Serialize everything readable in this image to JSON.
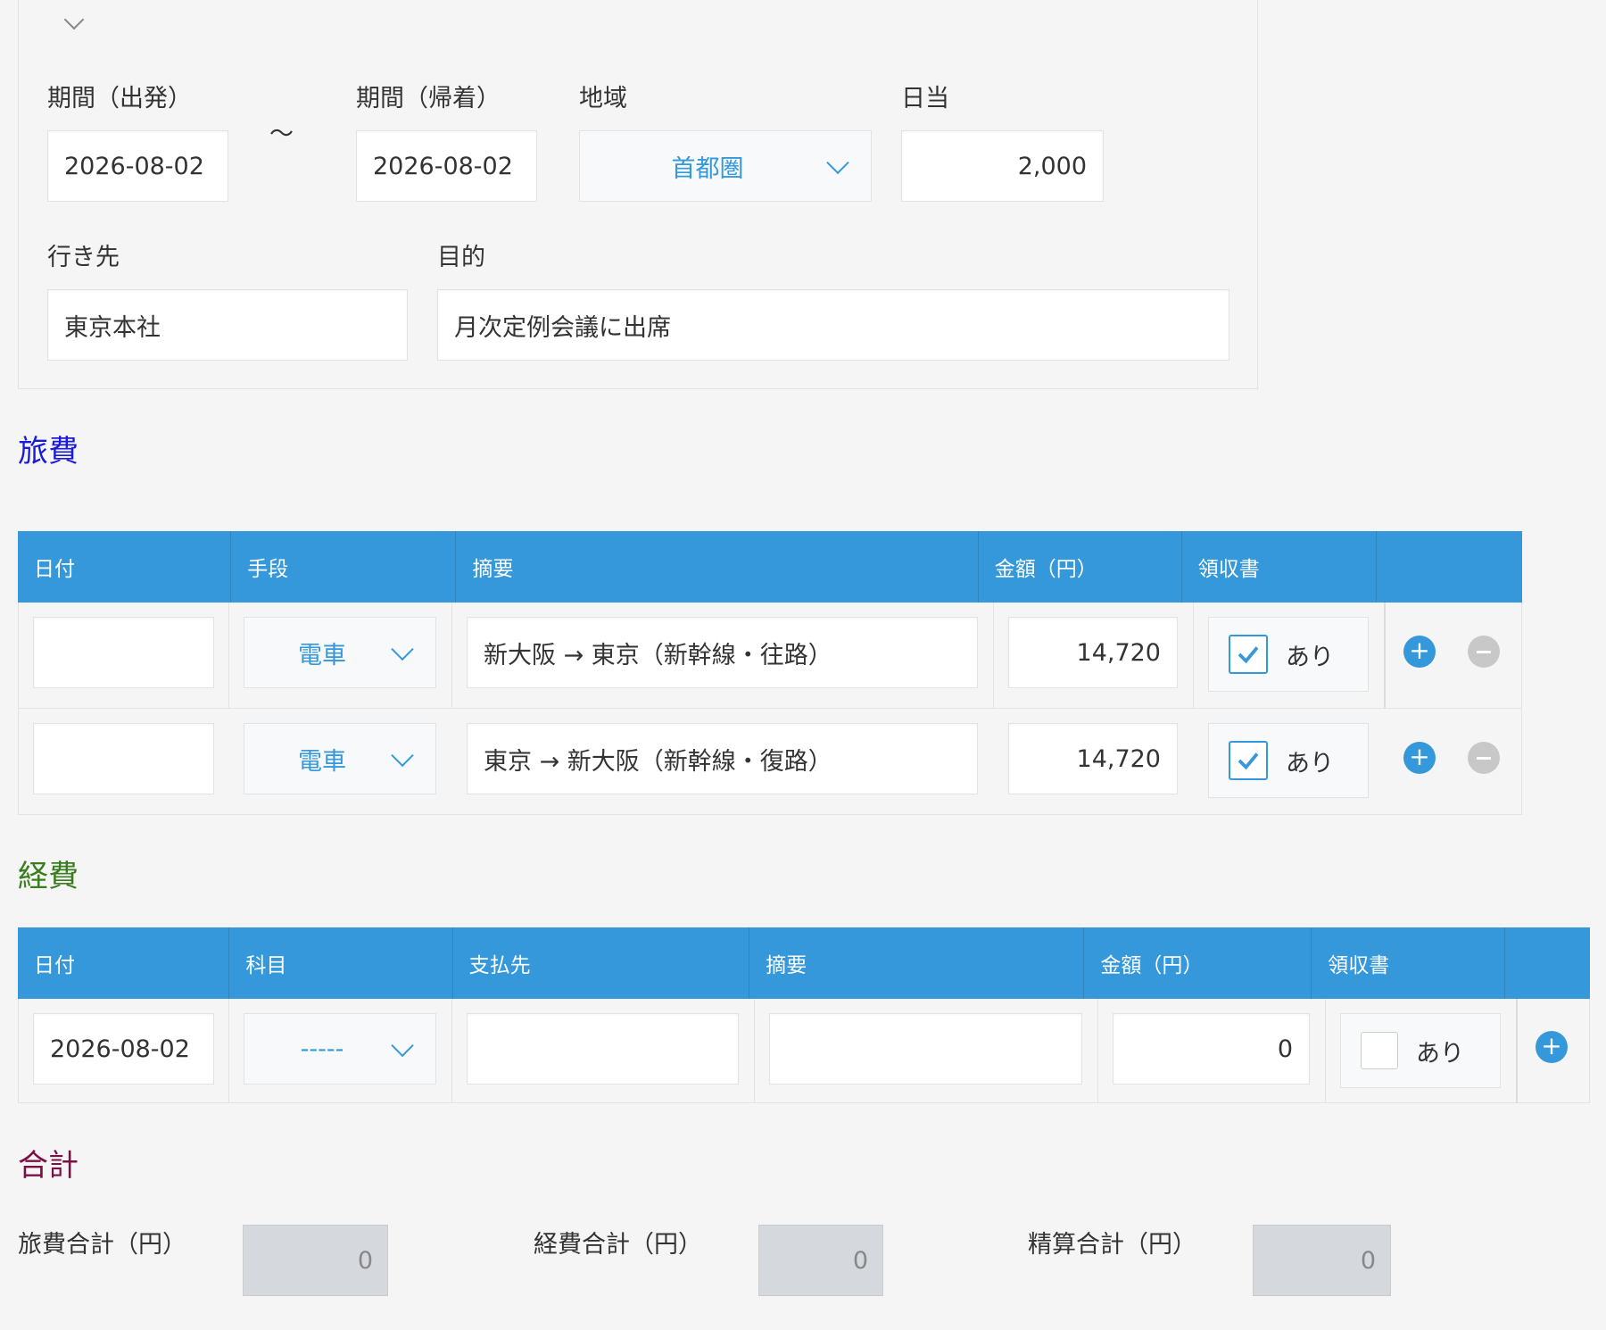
{
  "header_form": {
    "depart_label": "期間（出発）",
    "depart_value": "2026-08-02",
    "tilde": "～",
    "return_label": "期間（帰着）",
    "return_value": "2026-08-02",
    "region_label": "地域",
    "region_value": "首都圏",
    "daily_label": "日当",
    "daily_value": "2,000",
    "destination_label": "行き先",
    "destination_value": "東京本社",
    "purpose_label": "目的",
    "purpose_value": "月次定例会議に出席"
  },
  "travel": {
    "title": "旅費",
    "title_color": "#1a1adb",
    "headers": [
      "日付",
      "手段",
      "摘要",
      "金額（円）",
      "領収書"
    ],
    "rows": [
      {
        "date": "",
        "method": "電車",
        "summary": "新大阪 → 東京（新幹線・往路）",
        "amount": "14,720",
        "receipt_checked": true,
        "receipt_label": "あり"
      },
      {
        "date": "",
        "method": "電車",
        "summary": "東京 → 新大阪（新幹線・復路）",
        "amount": "14,720",
        "receipt_checked": true,
        "receipt_label": "あり"
      }
    ]
  },
  "expenses": {
    "title": "経費",
    "title_color": "#3a7d1e",
    "headers": [
      "日付",
      "科目",
      "支払先",
      "摘要",
      "金額（円）",
      "領収書"
    ],
    "rows": [
      {
        "date": "2026-08-02",
        "category": "-----",
        "payee": "",
        "summary": "",
        "amount": "0",
        "receipt_checked": false,
        "receipt_label": "あり"
      }
    ]
  },
  "totals": {
    "title": "合計",
    "title_color": "#7a1045",
    "travel_label": "旅費合計（円）",
    "travel_value": "0",
    "expense_label": "経費合計（円）",
    "expense_value": "0",
    "settlement_label": "精算合計（円）",
    "settlement_value": "0"
  },
  "colors": {
    "accent": "#3498db",
    "page_bg": "#f5f5f5"
  }
}
